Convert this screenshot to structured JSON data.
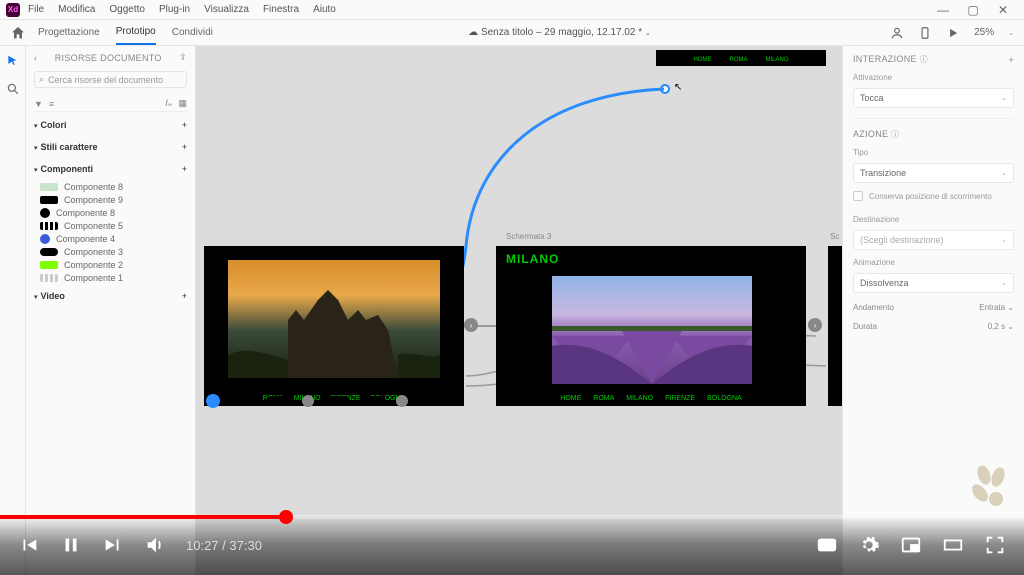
{
  "menu": {
    "items": [
      "File",
      "Modifica",
      "Oggetto",
      "Plug-in",
      "Visualizza",
      "Finestra",
      "Aiuto"
    ]
  },
  "topbar": {
    "tabs": [
      "Progettazione",
      "Prototipo",
      "Condividi"
    ],
    "active": 1,
    "doc_title": "Senza titolo – 29 maggio, 12.17.02",
    "zoom": "25%"
  },
  "left": {
    "head": "RISORSE DOCUMENTO",
    "search_placeholder": "Cerca risorse del documento",
    "sections": {
      "colori": "Colori",
      "stili": "Stili carattere",
      "componenti": "Componenti",
      "video": "Video"
    },
    "components": [
      {
        "name": "Componente 8",
        "color": "#c8e6c9"
      },
      {
        "name": "Componente 9",
        "color": "#000000"
      },
      {
        "name": "Componente 8",
        "color": "#000000",
        "shape": "circle"
      },
      {
        "name": "Componente 5",
        "color": "#000000",
        "shape": "dashes"
      },
      {
        "name": "Componente 4",
        "color": "#3b5bdb",
        "shape": "circle"
      },
      {
        "name": "Componente 3",
        "color": "#000000",
        "shape": "pill"
      },
      {
        "name": "Componente 2",
        "color": "#7fff00"
      },
      {
        "name": "Componente 1",
        "color": "#cccccc",
        "shape": "dashes"
      }
    ]
  },
  "canvas": {
    "topnav": {
      "items": [
        "HOME",
        "ROMA",
        "MILANO"
      ]
    },
    "artboard_label": "Schermata 3",
    "milano_title": "MILANO",
    "nav1": [
      "ROMA",
      "MILANO",
      "FIRENZE",
      "BOLOGNA"
    ],
    "nav2": [
      "HOME",
      "ROMA",
      "MILANO",
      "FIRENZE",
      "BOLOGNA"
    ]
  },
  "right": {
    "head": "INTERAZIONE",
    "activation_label": "Attivazione",
    "activation_value": "Tocca",
    "action_head": "AZIONE",
    "type_label": "Tipo",
    "type_value": "Transizione",
    "preserve_label": "Conserva posizione di scorrimento",
    "dest_label": "Destinazione",
    "dest_value": "(Scegli destinazione)",
    "anim_label": "Animazione",
    "anim_value": "Dissolvenza",
    "easing_label": "Andamento",
    "easing_value": "Entrata",
    "duration_label": "Durata",
    "duration_value": "0,2 s"
  },
  "video": {
    "current": "10:27",
    "total": "37:30",
    "progress_pct": 27.9
  }
}
